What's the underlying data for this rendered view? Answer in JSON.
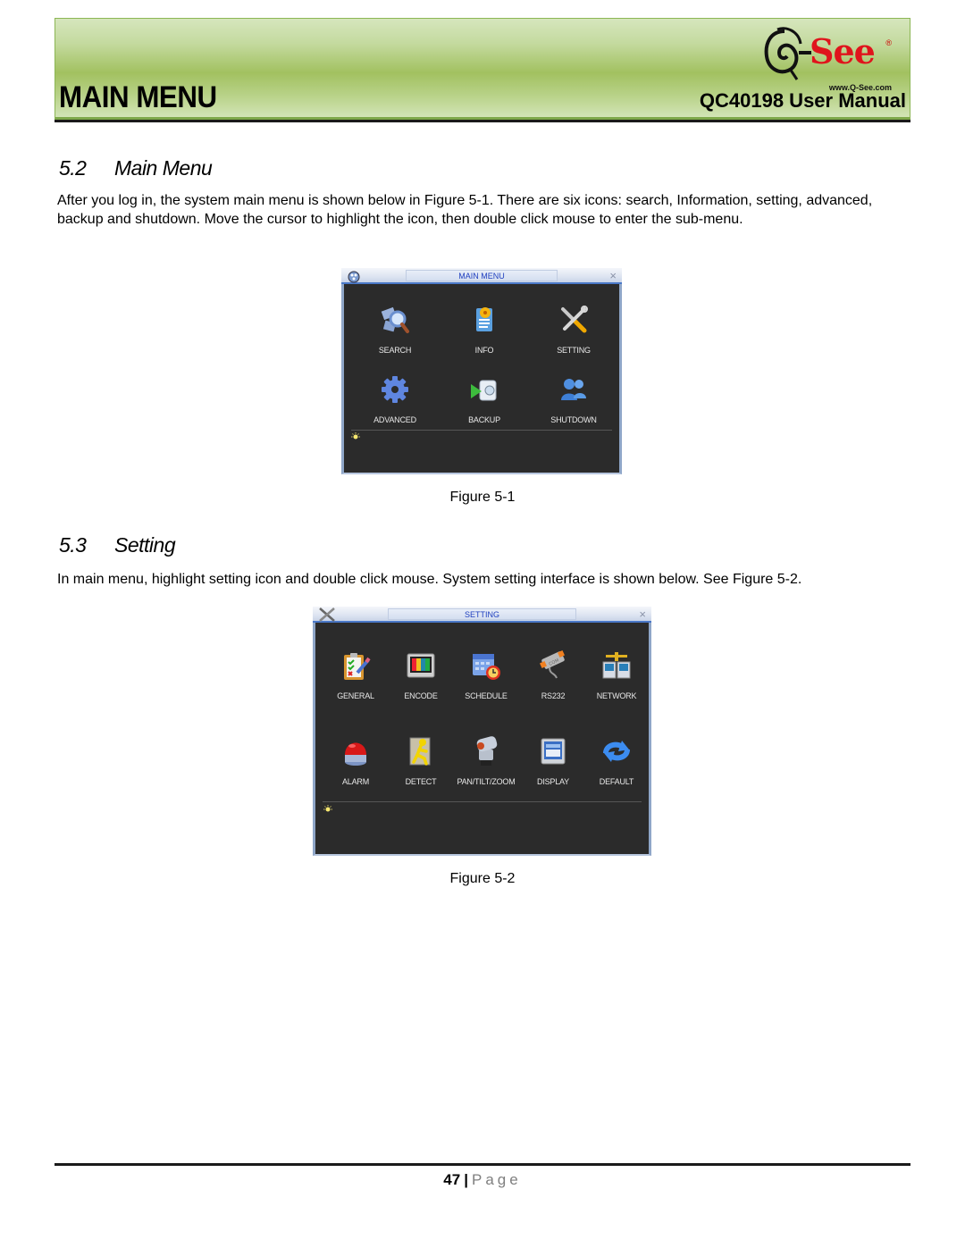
{
  "header": {
    "title": "MAIN MENU",
    "manual": "QC40198 User Manual",
    "logo": {
      "brand_prefix": "Q",
      "brand": "See",
      "registered": "®",
      "url": "www.Q-See.com"
    }
  },
  "sections": [
    {
      "number": "5.2",
      "title": "Main Menu",
      "paragraph": "After you log in, the system main menu is shown below in Figure 5-1.  There are six icons: search, Information, setting, advanced, backup and shutdown. Move the cursor to highlight the icon, then double click mouse to enter the sub-menu.",
      "figure_caption": "Figure 5-1"
    },
    {
      "number": "5.3",
      "title": "Setting",
      "paragraph": "In main menu, highlight setting icon and double click mouse. System setting interface is shown below. See Figure 5-2.",
      "figure_caption": "Figure 5-2"
    }
  ],
  "figure1": {
    "title": "MAIN MENU",
    "close": "×",
    "items": [
      {
        "label": "SEARCH",
        "icon": "search-icon"
      },
      {
        "label": "INFO",
        "icon": "info-icon"
      },
      {
        "label": "SETTING",
        "icon": "setting-icon"
      },
      {
        "label": "ADVANCED",
        "icon": "gear-icon"
      },
      {
        "label": "BACKUP",
        "icon": "backup-icon"
      },
      {
        "label": "SHUTDOWN",
        "icon": "shutdown-icon"
      }
    ]
  },
  "figure2": {
    "title": "SETTING",
    "close": "×",
    "items": [
      {
        "label": "GENERAL",
        "icon": "general-icon"
      },
      {
        "label": "ENCODE",
        "icon": "encode-icon"
      },
      {
        "label": "SCHEDULE",
        "icon": "schedule-icon"
      },
      {
        "label": "RS232",
        "icon": "rs232-icon"
      },
      {
        "label": "NETWORK",
        "icon": "network-icon"
      },
      {
        "label": "ALARM",
        "icon": "alarm-icon"
      },
      {
        "label": "DETECT",
        "icon": "detect-icon"
      },
      {
        "label": "PAN/TILT/ZOOM",
        "icon": "ptz-icon"
      },
      {
        "label": "DISPLAY",
        "icon": "display-icon"
      },
      {
        "label": "DEFAULT",
        "icon": "default-icon"
      }
    ]
  },
  "footer": {
    "page_number": "47",
    "separator": "|",
    "page_word": "Page"
  }
}
